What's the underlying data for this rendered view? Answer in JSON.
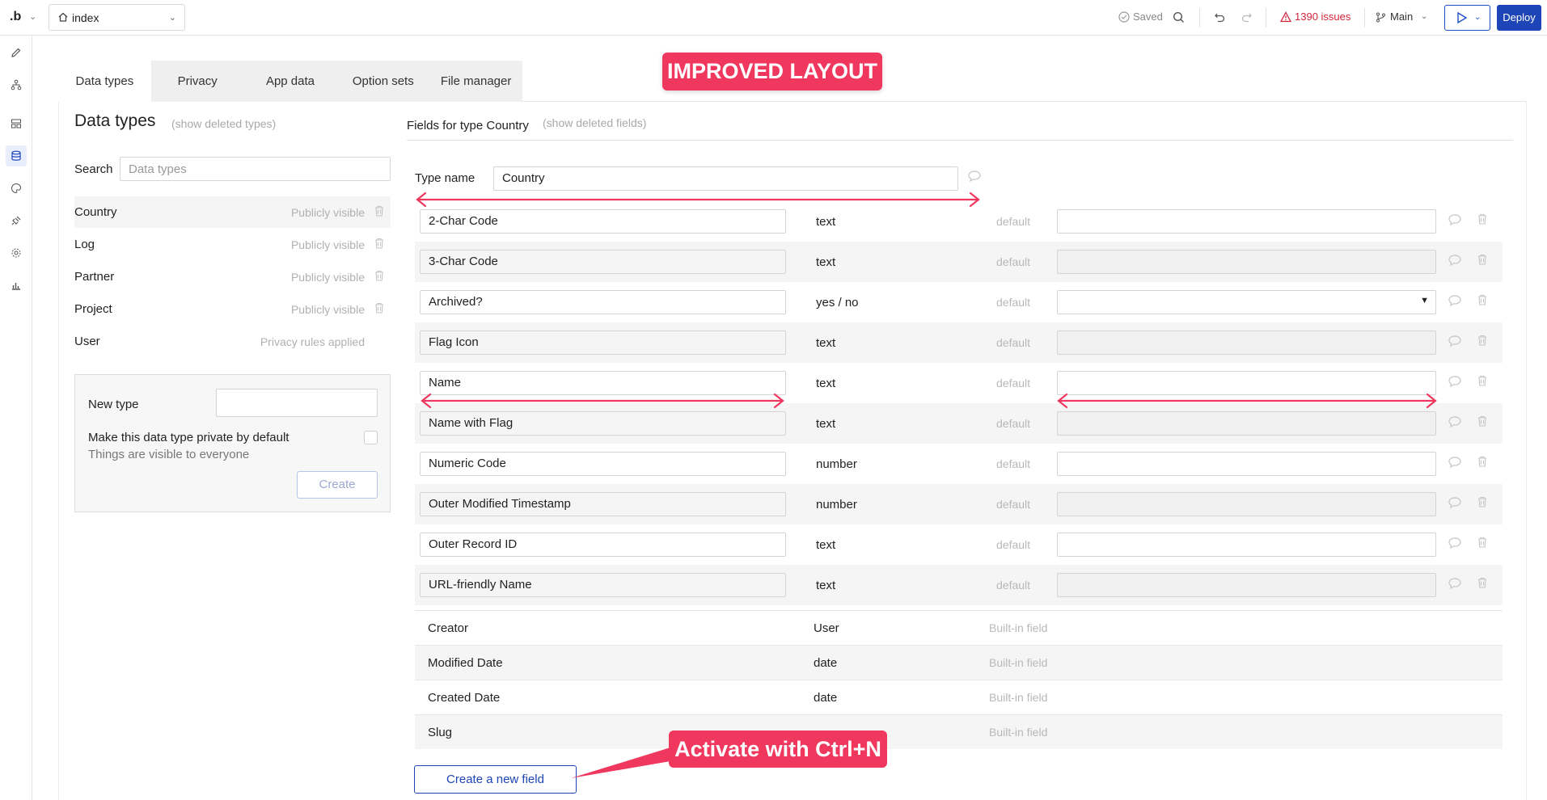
{
  "topbar": {
    "logo": ".b",
    "page": "index",
    "saved": "Saved",
    "issues": "1390 issues",
    "branch": "Main",
    "deploy": "Deploy"
  },
  "tabs": [
    "Data types",
    "Privacy",
    "App data",
    "Option sets",
    "File manager"
  ],
  "left": {
    "title": "Data types",
    "show_deleted": "(show deleted types)",
    "search_label": "Search",
    "search_placeholder": "Data types",
    "types": [
      {
        "name": "Country",
        "visibility": "Publicly visible"
      },
      {
        "name": "Log",
        "visibility": "Publicly visible"
      },
      {
        "name": "Partner",
        "visibility": "Publicly visible"
      },
      {
        "name": "Project",
        "visibility": "Publicly visible"
      },
      {
        "name": "User",
        "visibility": "Privacy rules applied"
      }
    ],
    "new_type_label": "New type",
    "private_label": "Make this data type private by default",
    "private_sub": "Things are visible to everyone",
    "create": "Create"
  },
  "right": {
    "title": "Fields for type Country",
    "show_deleted": "(show deleted fields)",
    "type_name_label": "Type name",
    "type_name_value": "Country",
    "default_label": "default",
    "fields": [
      {
        "name": "2-Char Code",
        "type": "text"
      },
      {
        "name": "3-Char Code",
        "type": "text"
      },
      {
        "name": "Archived?",
        "type": "yes / no"
      },
      {
        "name": "Flag Icon",
        "type": "text"
      },
      {
        "name": "Name",
        "type": "text"
      },
      {
        "name": "Name with Flag",
        "type": "text"
      },
      {
        "name": "Numeric Code",
        "type": "number"
      },
      {
        "name": "Outer Modified Timestamp",
        "type": "number"
      },
      {
        "name": "Outer Record ID",
        "type": "text"
      },
      {
        "name": "URL-friendly Name",
        "type": "text"
      }
    ],
    "builtin_note": "Built-in field",
    "builtin": [
      {
        "name": "Creator",
        "type": "User"
      },
      {
        "name": "Modified Date",
        "type": "date"
      },
      {
        "name": "Created Date",
        "type": "date"
      },
      {
        "name": "Slug",
        "type": ""
      }
    ],
    "new_field": "Create a new field"
  },
  "annotations": {
    "layout": "IMPROVED LAYOUT",
    "shortcut": "Activate with Ctrl+N",
    "color": "#f0385e"
  }
}
